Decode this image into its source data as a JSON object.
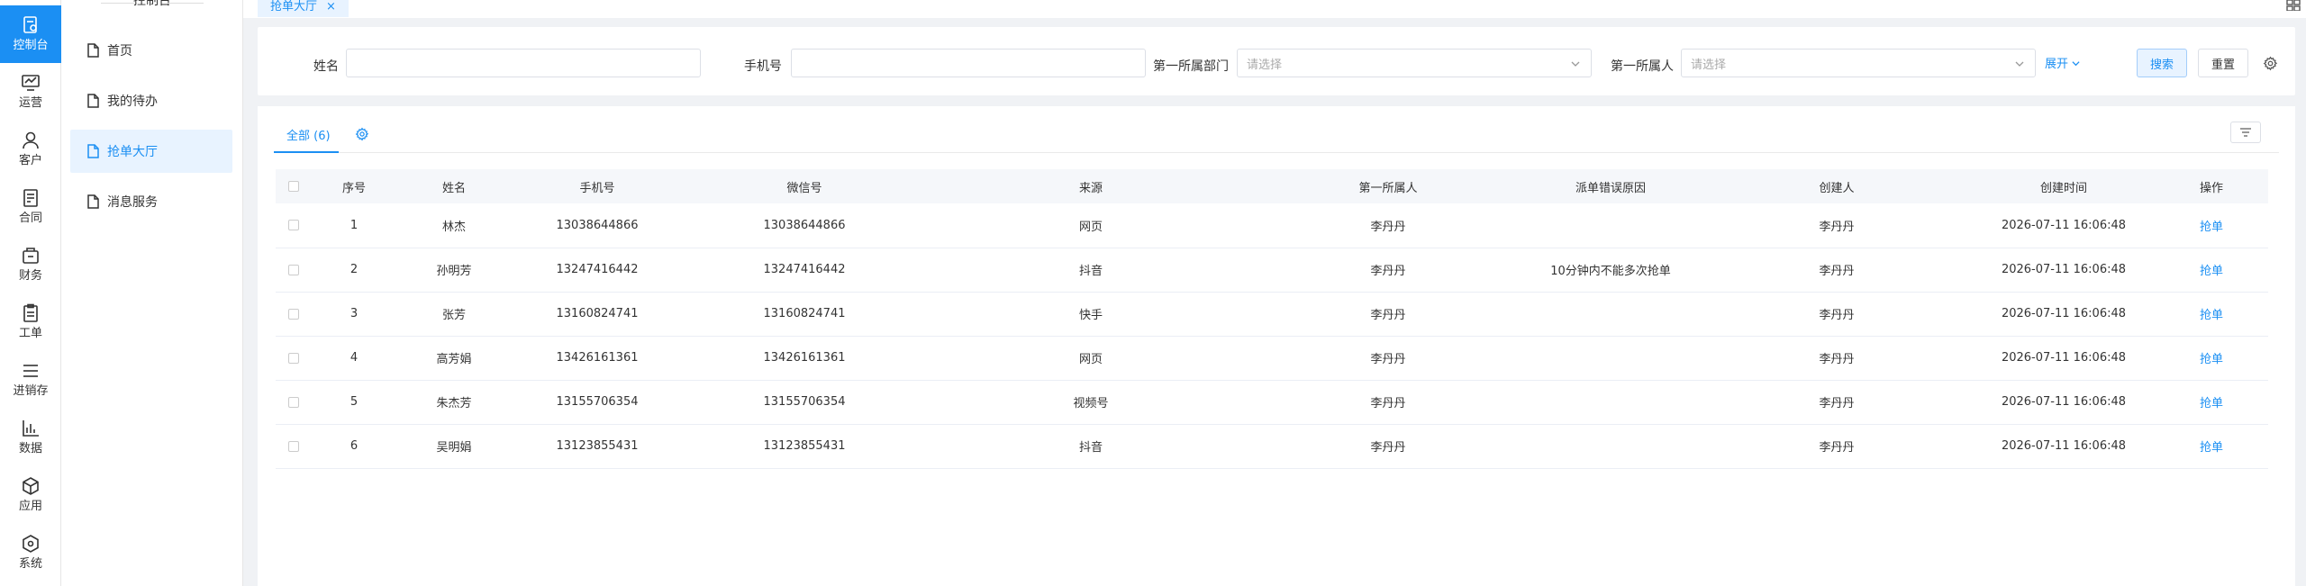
{
  "rail": [
    {
      "label": "控制台",
      "icon": "dashboard-icon"
    },
    {
      "label": "运营",
      "icon": "monitor-icon"
    },
    {
      "label": "客户",
      "icon": "user-icon"
    },
    {
      "label": "合同",
      "icon": "contract-icon"
    },
    {
      "label": "财务",
      "icon": "wallet-icon"
    },
    {
      "label": "工单",
      "icon": "clipboard-icon"
    },
    {
      "label": "进销存",
      "icon": "list-icon"
    },
    {
      "label": "数据",
      "icon": "chart-icon"
    },
    {
      "label": "应用",
      "icon": "cube-icon"
    },
    {
      "label": "系统",
      "icon": "hexagon-icon"
    }
  ],
  "submenu": {
    "title": "控制台",
    "items": [
      {
        "label": "首页"
      },
      {
        "label": "我的待办"
      },
      {
        "label": "抢单大厅"
      },
      {
        "label": "消息服务"
      }
    ]
  },
  "tabbar": {
    "tab_label": "抢单大厅",
    "close": "×"
  },
  "filter": {
    "name_label": "姓名",
    "name_value": "",
    "phone_label": "手机号",
    "phone_value": "",
    "dept_label": "第一所属部门",
    "dept_placeholder": "请选择",
    "owner_label": "第一所属人",
    "owner_placeholder": "请选择",
    "expand_label": "展开",
    "search_label": "搜索",
    "reset_label": "重置"
  },
  "list": {
    "tab_label": "全部 (6)",
    "columns": [
      "序号",
      "姓名",
      "手机号",
      "微信号",
      "来源",
      "第一所属人",
      "派单错误原因",
      "创建人",
      "创建时间",
      "操作"
    ],
    "rows": [
      {
        "no": "1",
        "name": "林杰",
        "phone": "13038644866",
        "wechat": "13038644866",
        "source": "网页",
        "owner": "李丹丹",
        "reason": "",
        "creator": "李丹丹",
        "created": "2026-07-11 16:06:48",
        "action": "抢单"
      },
      {
        "no": "2",
        "name": "孙明芳",
        "phone": "13247416442",
        "wechat": "13247416442",
        "source": "抖音",
        "owner": "李丹丹",
        "reason": "10分钟内不能多次抢单",
        "creator": "李丹丹",
        "created": "2026-07-11 16:06:48",
        "action": "抢单"
      },
      {
        "no": "3",
        "name": "张芳",
        "phone": "13160824741",
        "wechat": "13160824741",
        "source": "快手",
        "owner": "李丹丹",
        "reason": "",
        "creator": "李丹丹",
        "created": "2026-07-11 16:06:48",
        "action": "抢单"
      },
      {
        "no": "4",
        "name": "高芳娟",
        "phone": "13426161361",
        "wechat": "13426161361",
        "source": "网页",
        "owner": "李丹丹",
        "reason": "",
        "creator": "李丹丹",
        "created": "2026-07-11 16:06:48",
        "action": "抢单"
      },
      {
        "no": "5",
        "name": "朱杰芳",
        "phone": "13155706354",
        "wechat": "13155706354",
        "source": "视频号",
        "owner": "李丹丹",
        "reason": "",
        "creator": "李丹丹",
        "created": "2026-07-11 16:06:48",
        "action": "抢单"
      },
      {
        "no": "6",
        "name": "吴明娟",
        "phone": "13123855431",
        "wechat": "13123855431",
        "source": "抖音",
        "owner": "李丹丹",
        "reason": "",
        "creator": "李丹丹",
        "created": "2026-07-11 16:06:48",
        "action": "抢单"
      }
    ]
  },
  "colors": {
    "accent": "#1b8ff3",
    "accent_light": "#e8f3ff"
  }
}
